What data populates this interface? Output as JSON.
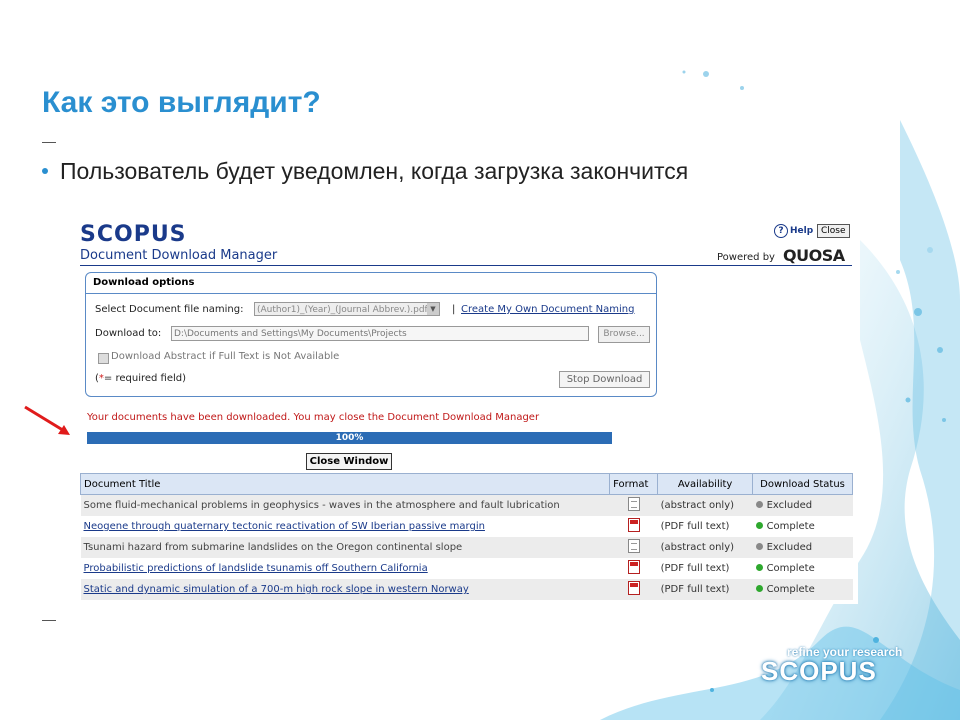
{
  "slide": {
    "title": "Как это выглядит?",
    "bullet": "Пользователь будет уведомлен, когда загрузка закончится",
    "brand_tagline": "refine your research",
    "brand_logo": "SCOPUS"
  },
  "app": {
    "logo": "SCOPUS",
    "manager_title": "Document Download Manager",
    "help_label": "Help",
    "close_label": "Close",
    "powered_by": "Powered by",
    "powered_brand": "QUOSA"
  },
  "options": {
    "header": "Download options",
    "naming_label": "Select Document file naming:",
    "naming_value": "(Author1)_(Year)_(Journal Abbrev.).pdf",
    "separator": "|",
    "create_naming_link": "Create My Own Document Naming",
    "download_to_label": "Download to:",
    "download_to_value": "D:\\Documents and Settings\\My Documents\\Projects",
    "browse_label": "Browse...",
    "abstract_checkbox_label": "Download Abstract if Full Text is Not Available",
    "required_open": "(",
    "required_star": "*",
    "required_text": "= required field)",
    "stop_label": "Stop Download"
  },
  "status": {
    "message": "Your documents have been downloaded.  You may close the Document Download Manager",
    "progress_text": "100%",
    "progress_value": 1.0,
    "close_window_label": "Close Window"
  },
  "table": {
    "headers": [
      "Document Title",
      "Format",
      "Availability",
      "Download Status"
    ],
    "rows": [
      {
        "title": "Some fluid-mechanical problems in geophysics - waves in the atmosphere and fault lubrication",
        "format_icon": "abstract-icon",
        "availability": "(abstract only)",
        "status": "Excluded",
        "status_color": "#888888",
        "link": false
      },
      {
        "title": "Neogene through quaternary tectonic reactivation of SW Iberian passive margin",
        "format_icon": "pdf-icon",
        "availability": "(PDF full text)",
        "status": "Complete",
        "status_color": "#2ea82e",
        "link": true
      },
      {
        "title": "Tsunami hazard from submarine landslides on the Oregon continental slope",
        "format_icon": "abstract-icon",
        "availability": "(abstract only)",
        "status": "Excluded",
        "status_color": "#888888",
        "link": false
      },
      {
        "title": "Probabilistic predictions of landslide tsunamis off Southern California",
        "format_icon": "pdf-icon",
        "availability": "(PDF full text)",
        "status": "Complete",
        "status_color": "#2ea82e",
        "link": true
      },
      {
        "title": "Static and dynamic simulation of a 700-m high rock slope in western Norway",
        "format_icon": "pdf-icon",
        "availability": "(PDF full text)",
        "status": "Complete",
        "status_color": "#2ea82e",
        "link": true
      }
    ]
  },
  "colors": {
    "title_blue": "#2a8fd0",
    "scopus_navy": "#1a3a8a",
    "progress_blue": "#2b6cb5",
    "error_red": "#c01818"
  }
}
